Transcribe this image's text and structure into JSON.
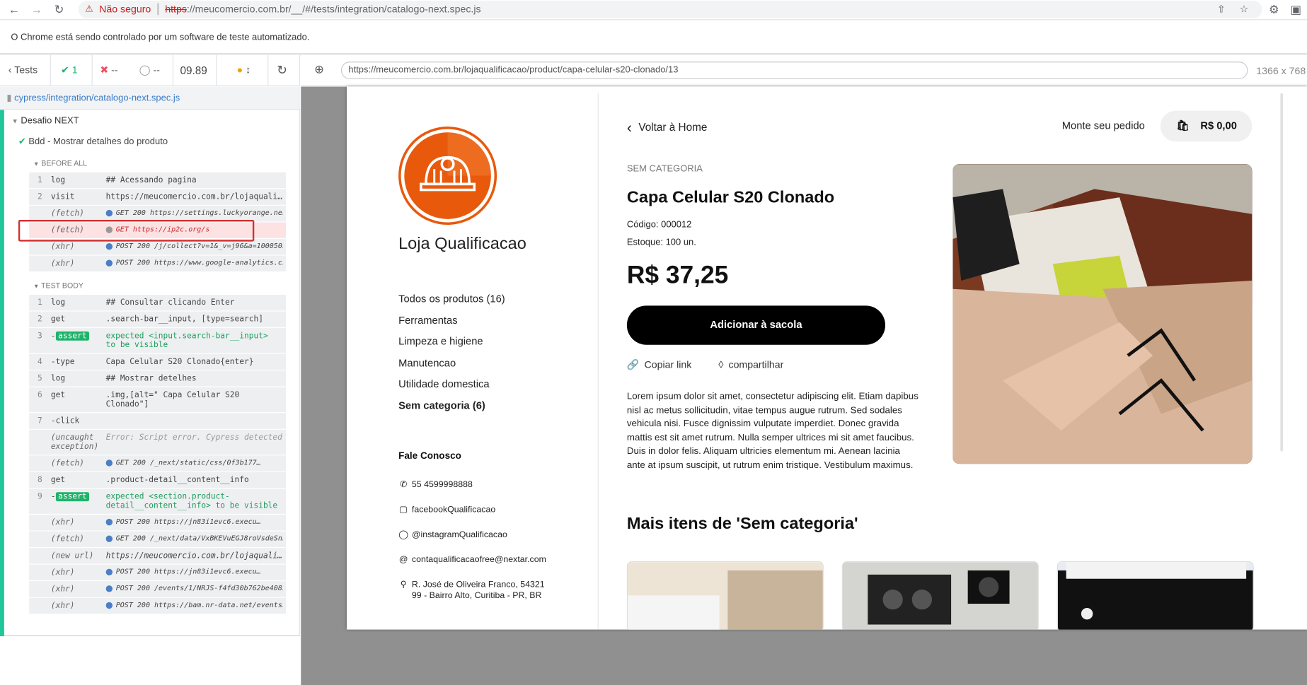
{
  "browser": {
    "not_secure": "Não seguro",
    "url_scheme": "https",
    "url_rest": "://meucomercio.com.br/__/#/tests/integration/catalogo-next.spec.js",
    "info": "O Chrome está sendo controlado por um software de teste automatizado."
  },
  "cypress": {
    "tests_label": "Tests",
    "passed": "1",
    "failed": "--",
    "pending": "--",
    "duration": "09.89",
    "spec_path": "cypress/integration/catalogo-next.spec.js",
    "suite": "Desafio NEXT",
    "test": "Bdd - Mostrar detalhes do produto",
    "before_all": "BEFORE ALL",
    "test_body": "TEST BODY",
    "before_cmds": [
      {
        "n": "1",
        "k": "log",
        "v": "## Acessando pagina"
      },
      {
        "n": "2",
        "k": "visit",
        "v": "https://meucomercio.com.br/lojaquali…"
      },
      {
        "n": "",
        "k": "(fetch)",
        "v": "GET 200 https://settings.luckyorange.ne…"
      },
      {
        "n": "",
        "k": "(fetch)",
        "v": "GET https://ip2c.org/s"
      },
      {
        "n": "",
        "k": "(xhr)",
        "v": "POST 200 /j/collect?v=1&_v=j96&a=100050…"
      },
      {
        "n": "",
        "k": "(xhr)",
        "v": "POST 200 https://www.google-analytics.c…"
      }
    ],
    "body_cmds": [
      {
        "n": "1",
        "k": "log",
        "v": "## Consultar clicando Enter"
      },
      {
        "n": "2",
        "k": "get",
        "v": ".search-bar__input, [type=search]"
      },
      {
        "n": "3",
        "k": "assert",
        "v": "expected <input.search-bar__input>",
        "v2": "to be visible"
      },
      {
        "n": "4",
        "k": "-type",
        "v": "Capa Celular S20 Clonado{enter}"
      },
      {
        "n": "5",
        "k": "log",
        "v": "## Mostrar detelhes"
      },
      {
        "n": "6",
        "k": "get",
        "v": ".img,[alt=\" Capa Celular S20",
        "v2": "Clonado\"]"
      },
      {
        "n": "7",
        "k": "-click",
        "v": ""
      },
      {
        "n": "",
        "k": "(uncaught",
        "k2": "exception)",
        "v": "Error: Script error. Cypress detected that…"
      },
      {
        "n": "",
        "k": "(fetch)",
        "v": "GET 200 /_next/static/css/0f3b177…"
      },
      {
        "n": "8",
        "k": "get",
        "v": ".product-detail__content__info"
      },
      {
        "n": "9",
        "k": "assert",
        "v": "expected <section.product-",
        "v2": "detail__content__info> to be visible"
      },
      {
        "n": "",
        "k": "(xhr)",
        "v": "POST 200 https://jn83i1evc6.execu…"
      },
      {
        "n": "",
        "k": "(fetch)",
        "v": "GET 200 /_next/data/VxBKEVuEGJ8roVsdeSn…"
      },
      {
        "n": "",
        "k": "(new url)",
        "v": "https://meucomercio.com.br/lojaquali…"
      },
      {
        "n": "",
        "k": "(xhr)",
        "v": "POST 200 https://jn83i1evc6.execu…"
      },
      {
        "n": "",
        "k": "(xhr)",
        "v": "POST 200 /events/1/NRJS-f4fd30b762be408…"
      },
      {
        "n": "",
        "k": "(xhr)",
        "v": "POST 200 https://bam.nr-data.net/events…"
      }
    ]
  },
  "aut": {
    "url": "https://meucomercio.com.br/lojaqualificacao/product/capa-celular-s20-clonado/13",
    "viewport": "1366 x 768"
  },
  "store": {
    "name": "Loja Qualificacao",
    "menu": [
      "Todos os produtos (16)",
      "Ferramentas",
      "Limpeza e higiene",
      "Manutencao",
      "Utilidade domestica",
      "Sem categoria  (6)"
    ],
    "contact_title": "Fale Conosco",
    "phone": "55 4599998888",
    "facebook": "facebookQualificacao",
    "instagram": "@instagramQualificacao",
    "email": "contaqualificacaofree@nextar.com",
    "address1": "R. José de Oliveira Franco, 54321",
    "address2": "99 - Bairro Alto, Curitiba - PR, BR"
  },
  "product": {
    "back": "Voltar à Home",
    "order": "Monte seu pedido",
    "cart_total": "R$ 0,00",
    "category": "SEM CATEGORIA",
    "title": "Capa Celular S20 Clonado",
    "code": "Código: 000012",
    "stock": "Estoque: 100 un.",
    "price": "R$ 37,25",
    "add_button": "Adicionar à sacola",
    "copy_link": "Copiar link",
    "share": "compartilhar",
    "description": "Lorem ipsum dolor sit amet, consectetur adipiscing elit. Etiam dapibus nisl ac metus sollicitudin, vitae tempus augue rutrum. Sed sodales vehicula nisi. Fusce dignissim vulputate imperdiet. Donec gravida mattis est sit amet rutrum. Nulla semper ultrices mi sit amet faucibus. Duis in dolor felis. Aliquam ultricies elementum mi. Aenean lacinia ante at ipsum suscipit, ut rutrum enim tristique. Vestibulum maximus.",
    "more_title": "Mais itens de 'Sem categoria'"
  },
  "colors": {
    "cypress_green": "#1fc79a",
    "logo_orange": "#e8590c",
    "highlight_red": "#d32f2f",
    "assert_green": "#1fb36a"
  },
  "icons": [
    "back-arrow-icon",
    "forward-arrow-icon",
    "reload-icon",
    "warning-icon",
    "share-icon",
    "star-icon",
    "extensions-icon",
    "sidebar-icon",
    "check-icon",
    "x-icon",
    "spinner-icon",
    "crosshair-icon",
    "bag-icon",
    "link-icon",
    "share-nodes-icon",
    "whatsapp-icon",
    "facebook-icon",
    "instagram-icon",
    "at-icon",
    "pin-icon",
    "chevron-left-icon"
  ]
}
